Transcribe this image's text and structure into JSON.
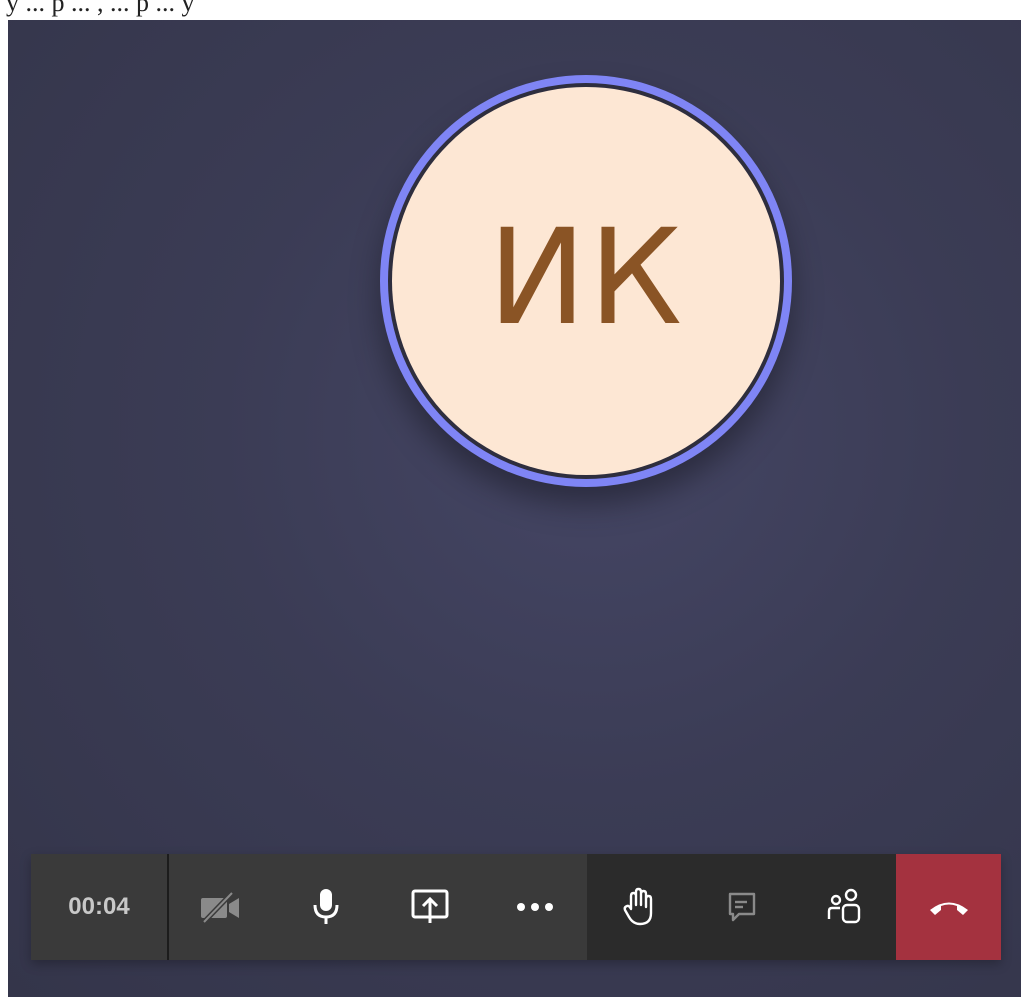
{
  "top_strip": {
    "text": "у ... р ... , ... р ... у"
  },
  "participant": {
    "initials": "ИК",
    "ring_color": "#7f85f5",
    "avatar_bg": "#fde7d4",
    "initials_color": "#8a5425"
  },
  "call_controls": {
    "timer": "00:04",
    "buttons": [
      {
        "name": "camera-off",
        "icon": "camera-off-icon",
        "state": "off"
      },
      {
        "name": "microphone",
        "icon": "microphone-icon",
        "state": "on"
      },
      {
        "name": "share-screen",
        "icon": "share-screen-icon"
      },
      {
        "name": "more-actions",
        "icon": "more-dots-icon"
      },
      {
        "name": "raise-hand",
        "icon": "raise-hand-icon"
      },
      {
        "name": "chat",
        "icon": "chat-icon",
        "state": "disabled"
      },
      {
        "name": "participants",
        "icon": "participants-icon"
      },
      {
        "name": "hang-up",
        "icon": "hang-up-icon"
      }
    ],
    "colors": {
      "bar_bg": "#3a3a3a",
      "bar_bg_secondary": "#2b2b2b",
      "hangup_bg": "#a4323f",
      "icon_color": "#ffffff",
      "icon_disabled": "#8a8a8a"
    }
  }
}
